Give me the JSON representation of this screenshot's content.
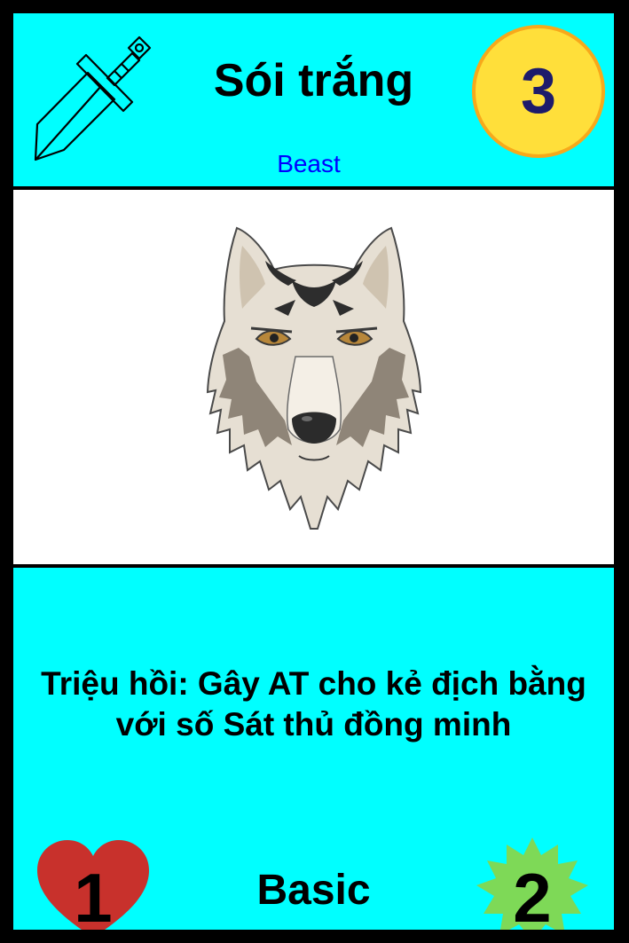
{
  "card": {
    "name": "Sói trắng",
    "tribe": "Beast",
    "cost": "3",
    "ability": "Triệu hồi: Gây AT cho kẻ địch bằng với số Sát thủ đồng minh",
    "health": "1",
    "rarity": "Basic",
    "attack": "2",
    "class_icon": "sword-icon",
    "art": "wolf-head-illustration"
  },
  "colors": {
    "frame": "#000000",
    "panel": "#00ffff",
    "tribe_text": "#0000ff",
    "cost_fill": "#ffdf3a",
    "cost_border": "#f7a91b",
    "cost_text": "#1d1b6b",
    "health_heart": "#c8312c",
    "attack_burst": "#7ed957"
  }
}
